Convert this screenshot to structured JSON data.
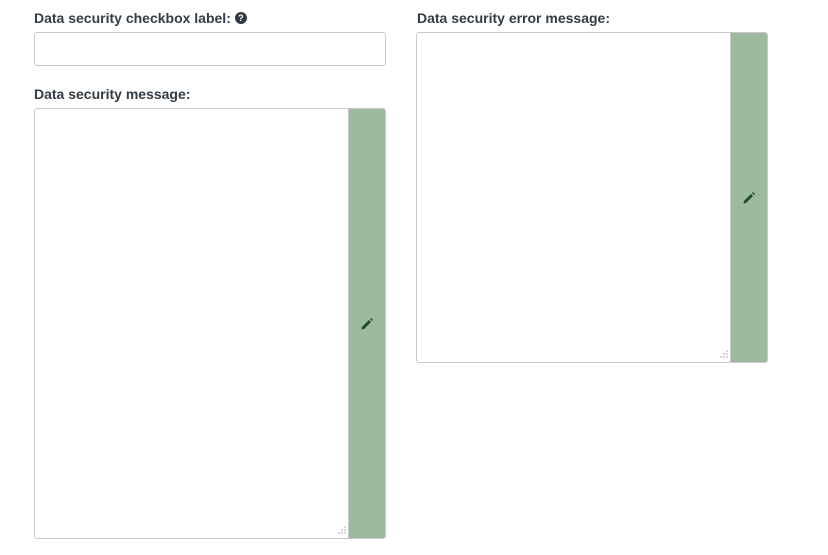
{
  "left": {
    "checkbox_label": "Data security checkbox label:",
    "checkbox_value": "",
    "message_label": "Data security message:",
    "message_value": ""
  },
  "right": {
    "error_label": "Data security error message:",
    "error_value": ""
  },
  "icons": {
    "help": "question-circle-icon",
    "edit": "pencil-icon",
    "grip": "resize-grip-icon"
  },
  "colors": {
    "label_text": "#333c44",
    "edit_bar": "#9dba9f",
    "pencil": "#1d4d1e",
    "border": "#c9c9c9"
  }
}
